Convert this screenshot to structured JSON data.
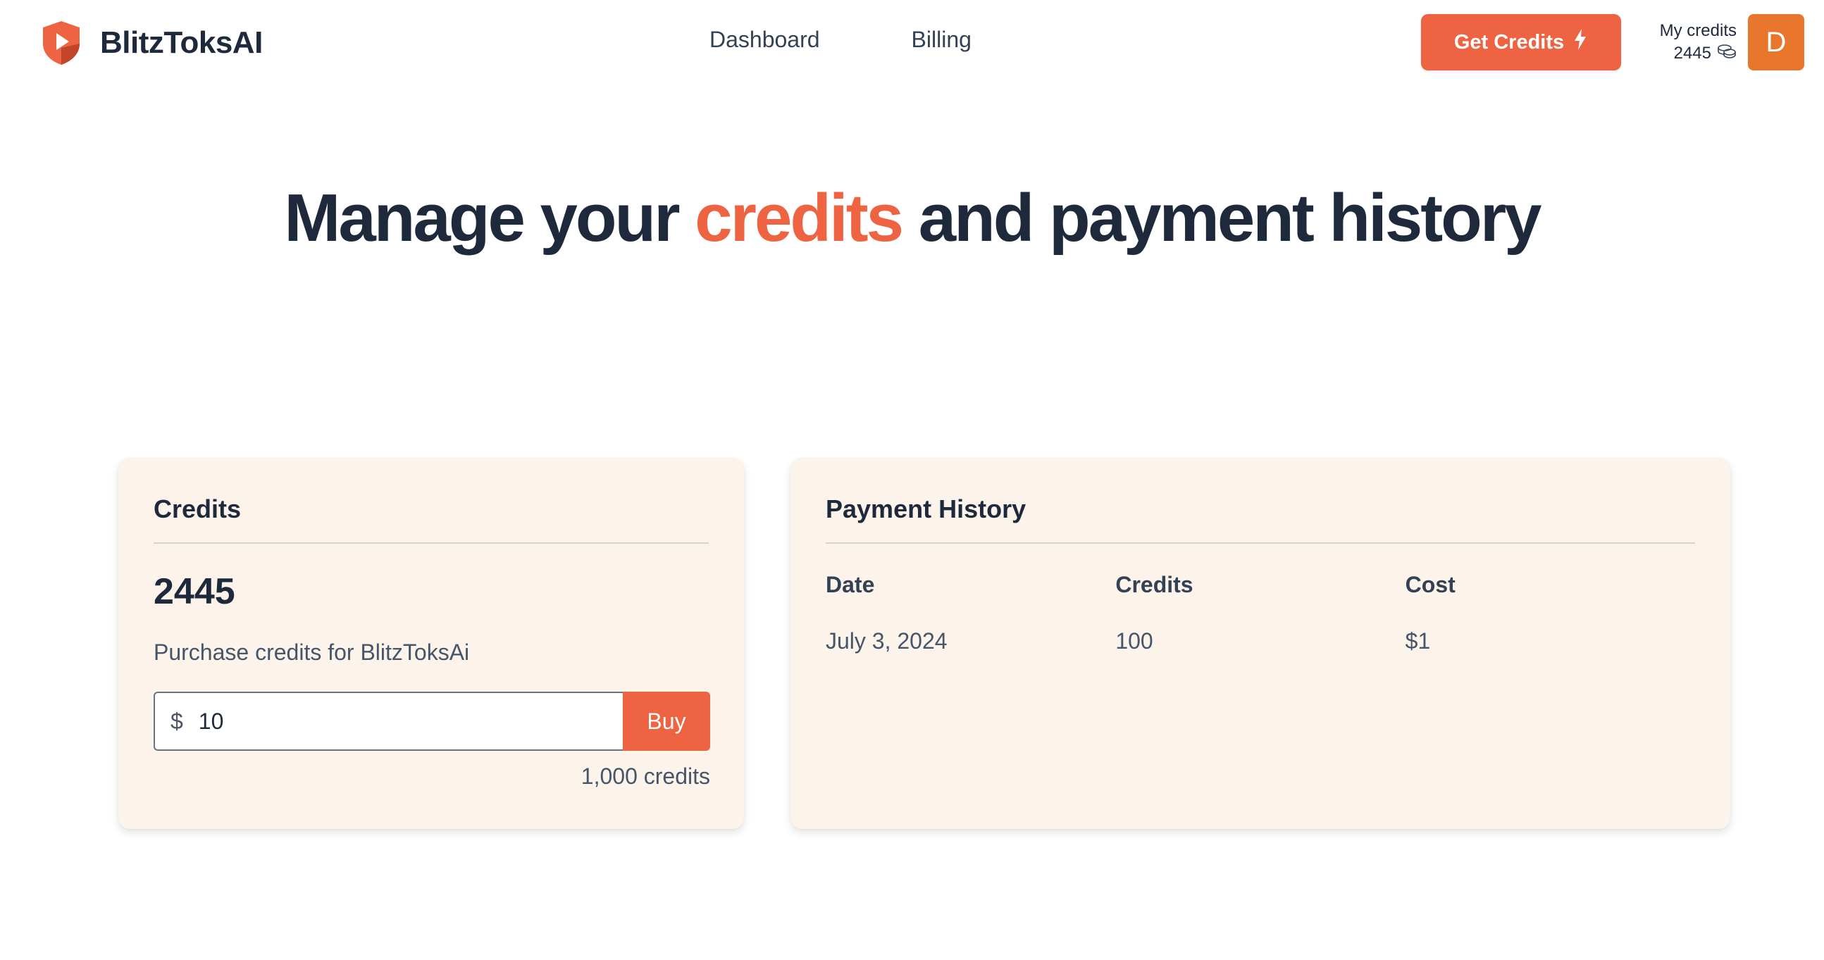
{
  "header": {
    "brand_name": "BlitzToksAI",
    "logo_icon": "shield-play-icon",
    "nav": [
      {
        "label": "Dashboard"
      },
      {
        "label": "Billing"
      }
    ],
    "get_credits_label": "Get Credits",
    "get_credits_icon": "lightning-icon",
    "my_credits_label": "My credits",
    "my_credits_value": "2445",
    "coins_icon": "coins-icon",
    "avatar_initial": "D"
  },
  "hero": {
    "title_before": "Manage your ",
    "title_accent": "credits",
    "title_after": " and payment history"
  },
  "credits_card": {
    "title": "Credits",
    "total": "2445",
    "purchase_label": "Purchase credits for BlitzToksAi",
    "currency_symbol": "$",
    "amount_value": "10",
    "buy_label": "Buy",
    "estimate": "1,000 credits"
  },
  "history_card": {
    "title": "Payment History",
    "columns": [
      "Date",
      "Credits",
      "Cost"
    ],
    "rows": [
      {
        "date": "July 3, 2024",
        "credits": "100",
        "cost": "$1"
      }
    ]
  },
  "colors": {
    "accent": "#ee6341",
    "avatar": "#e8762c",
    "card_bg": "#fcf3eb",
    "text_dark": "#1e293b"
  }
}
